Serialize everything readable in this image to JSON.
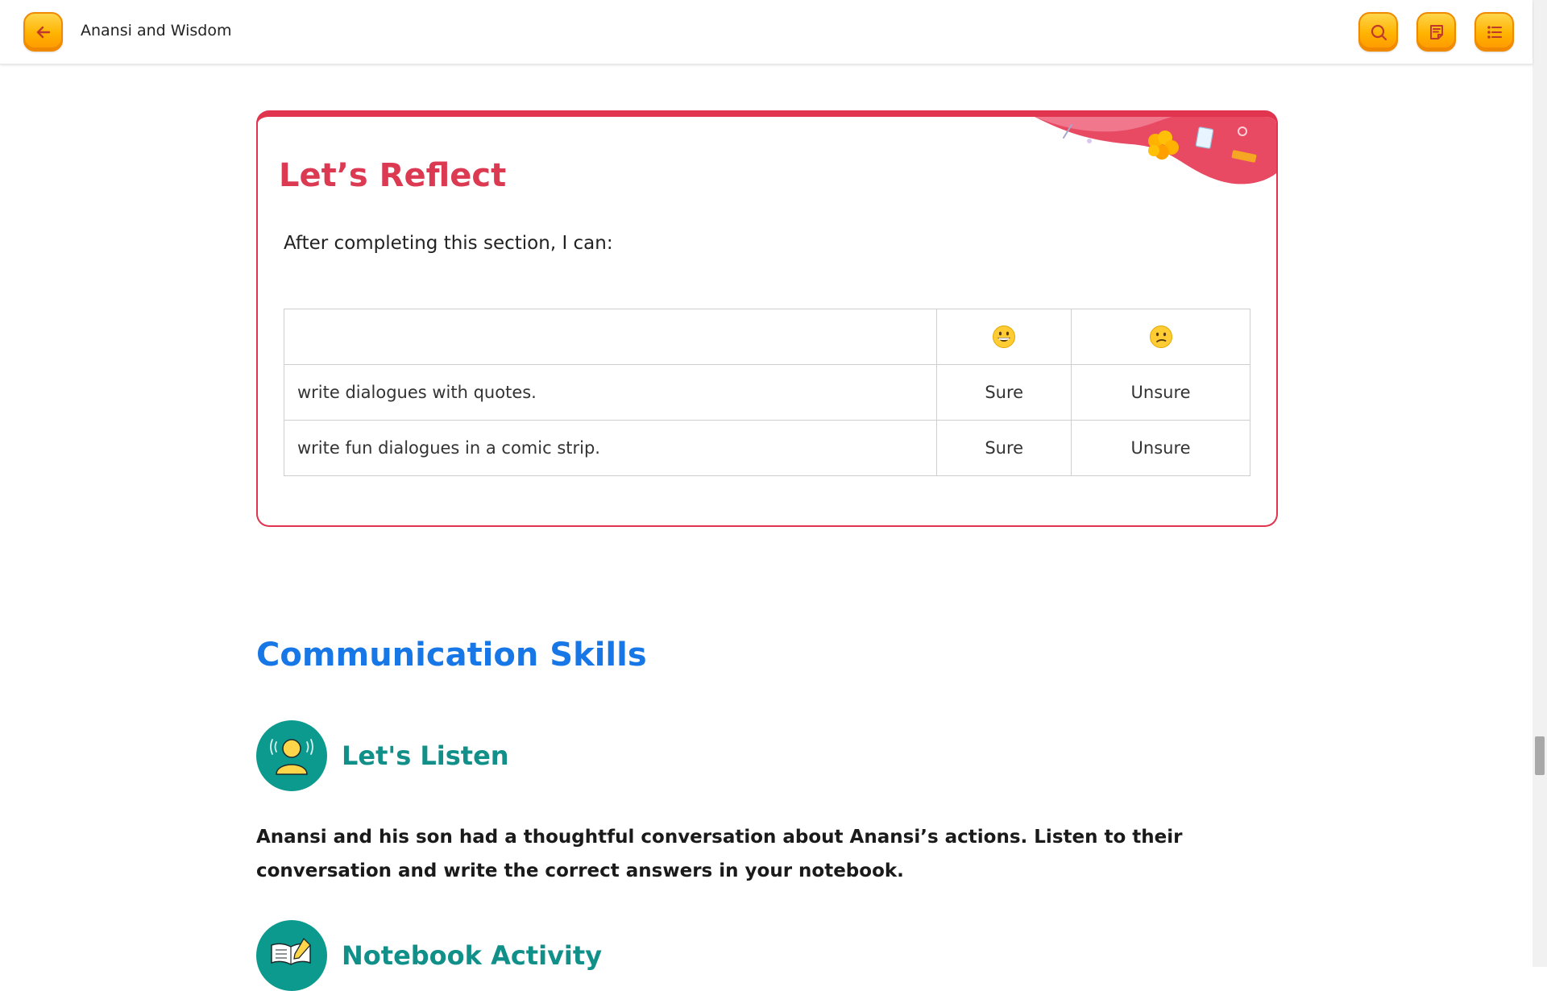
{
  "header": {
    "title": "Anansi and Wisdom",
    "back_icon": "arrow-left-icon",
    "search_icon": "search-icon",
    "notes_icon": "notes-icon",
    "menu_icon": "list-menu-icon",
    "button_color": "#FFB300"
  },
  "reflect": {
    "title": "Let’s Reflect",
    "intro": "After completing this section, I can:",
    "accent_color": "#E0344F",
    "columns": {
      "skill": "",
      "sure_icon": "grinning-face-icon",
      "unsure_icon": "confused-face-icon"
    },
    "rows": [
      {
        "skill": "write dialogues with quotes.",
        "sure": "Sure",
        "unsure": "Unsure"
      },
      {
        "skill": "write fun dialogues in a comic strip.",
        "sure": "Sure",
        "unsure": "Unsure"
      }
    ]
  },
  "communication": {
    "heading": "Communication Skills",
    "heading_color": "#1877E6",
    "listen": {
      "title": "Let's Listen",
      "icon": "listening-person-icon",
      "text": "Anansi and his son had a thoughtful conversation about Anansi’s actions. Listen to their conversation and write the correct answers in your notebook."
    },
    "notebook": {
      "title": "Notebook Activity",
      "icon": "notebook-pencil-icon"
    },
    "teal_color": "#0C9A8F"
  }
}
